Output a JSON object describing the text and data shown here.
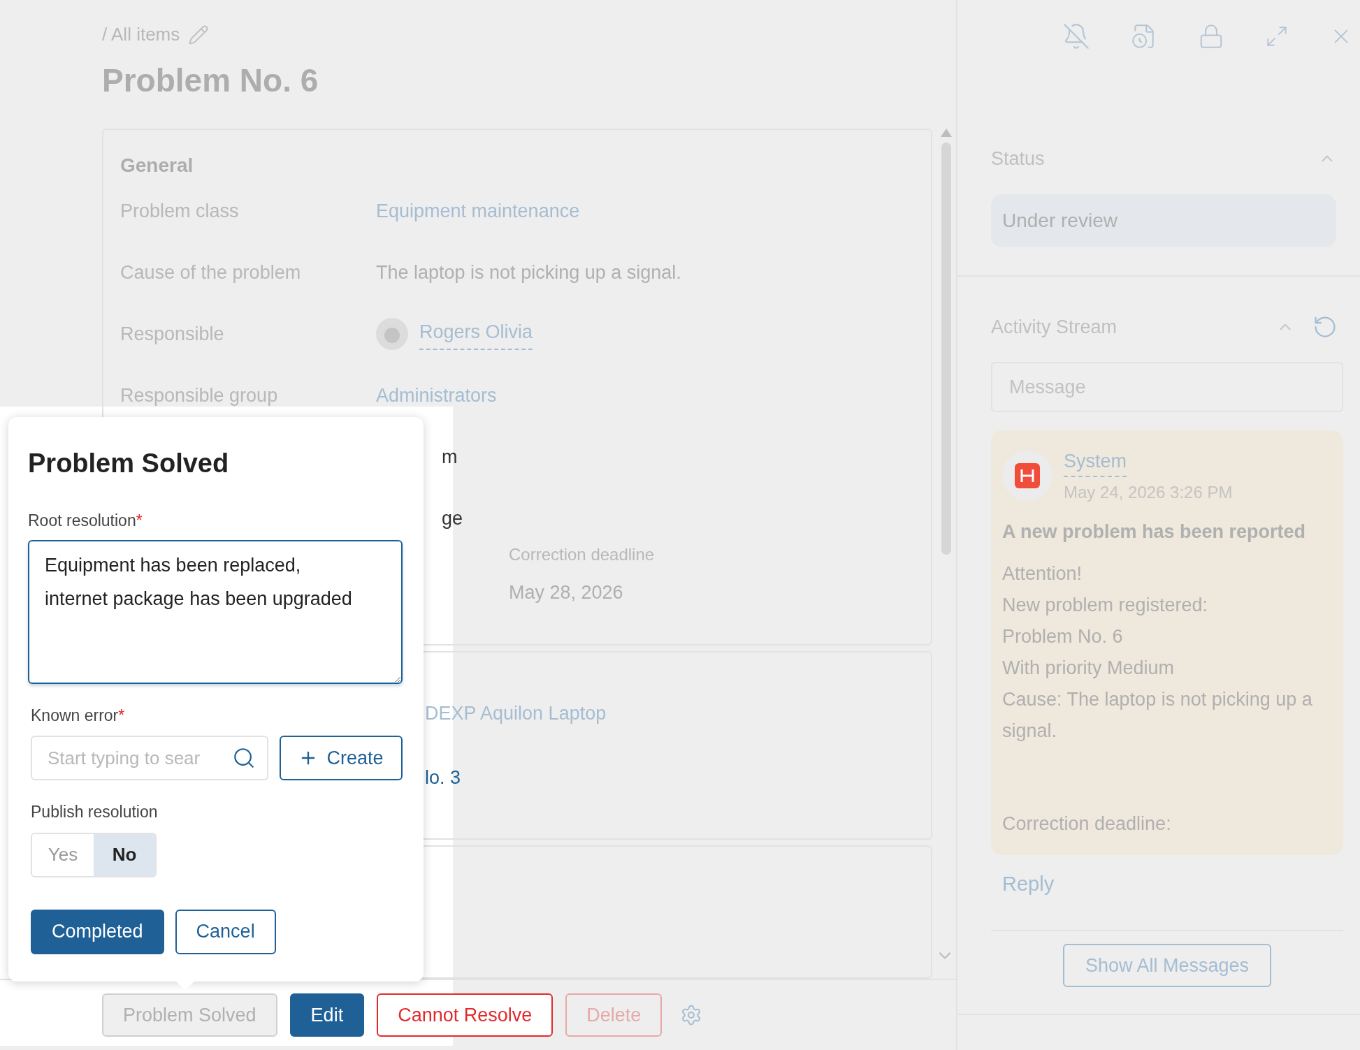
{
  "breadcrumb": "/ All items",
  "title": "Problem No. 6",
  "general": {
    "heading": "General",
    "fields": [
      {
        "label": "Problem class",
        "value": "Equipment maintenance",
        "kind": "link"
      },
      {
        "label": "Cause of the problem",
        "value": "The laptop is not picking up a signal.",
        "kind": "text"
      },
      {
        "label": "Responsible",
        "value": "Rogers Olivia",
        "kind": "user"
      },
      {
        "label": "Responsible group",
        "value": "Administrators",
        "kind": "link"
      }
    ],
    "partial_values": [
      "m",
      "ge"
    ],
    "deadline": {
      "label": "Correction deadline",
      "value": "May 28, 2026"
    }
  },
  "second_card": {
    "values": [
      {
        "text": "DEXP Aquilon Laptop",
        "kind": "link"
      },
      {
        "text": "lo. 3",
        "kind": "text"
      }
    ]
  },
  "actions": [
    {
      "label": "Problem Solved",
      "kind": "secondary"
    },
    {
      "label": "Edit",
      "kind": "primary"
    },
    {
      "label": "Cannot Resolve",
      "kind": "danger"
    },
    {
      "label": "Delete",
      "kind": "danger-muted"
    }
  ],
  "status": {
    "heading": "Status",
    "value": "Under review"
  },
  "activity": {
    "heading": "Activity Stream",
    "message_placeholder": "Message",
    "post": {
      "author": "System",
      "time": "May 24, 2026 3:26 PM",
      "subject": "A new problem has been reported",
      "lines": [
        "Attention!",
        "New problem registered:",
        "Problem No. 6",
        "With priority Medium",
        "Cause: The laptop is not picking up a signal."
      ],
      "footer": "Correction deadline:"
    },
    "reply": "Reply",
    "show_all": "Show All Messages"
  },
  "dialog": {
    "title": "Problem Solved",
    "root_resolution": {
      "label": "Root resolution",
      "required_mark": "*",
      "value": "Equipment has been replaced,\ninternet package has been upgraded"
    },
    "known_error": {
      "label": "Known error",
      "required_mark": "*",
      "placeholder": "Start typing to sear",
      "create": "Create"
    },
    "publish": {
      "label": "Publish resolution",
      "options": [
        {
          "label": "Yes",
          "selected": false
        },
        {
          "label": "No",
          "selected": true
        }
      ]
    },
    "buttons": [
      {
        "label": "Completed",
        "kind": "primary"
      },
      {
        "label": "Cancel",
        "kind": "secondary"
      }
    ]
  }
}
